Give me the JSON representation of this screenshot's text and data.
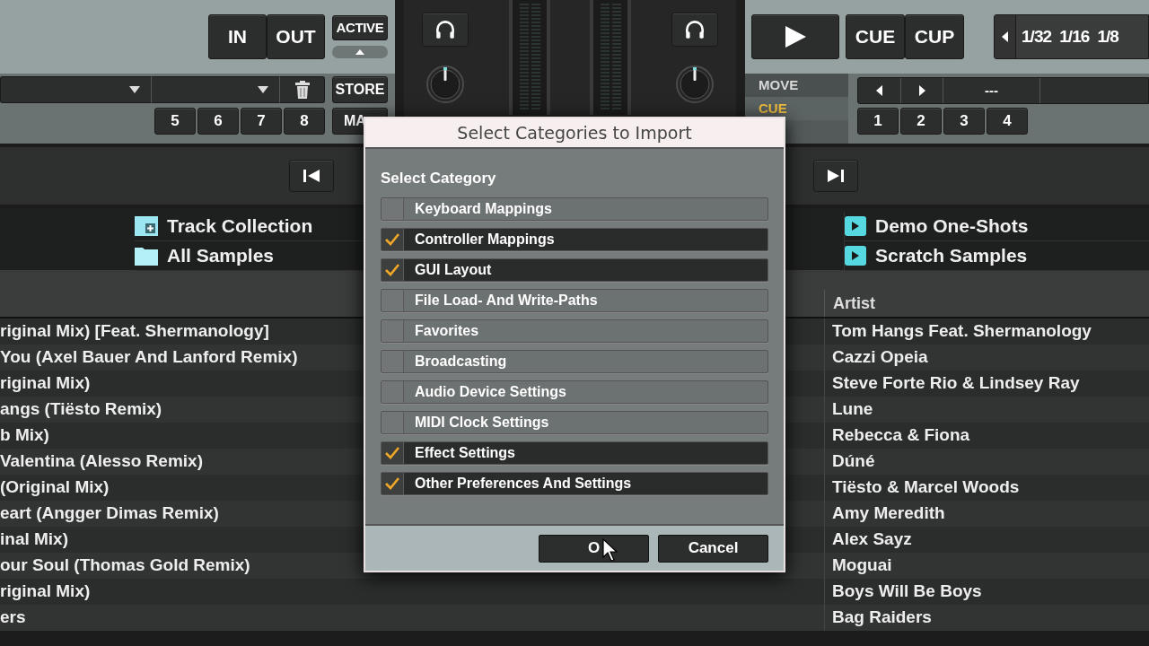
{
  "left_deck": {
    "loop_buttons": [
      "IN",
      "OUT"
    ],
    "active_button": "ACTIVE",
    "store_button": "STORE",
    "hotcue_buttons": [
      "5",
      "6",
      "7",
      "8"
    ],
    "map_button": "MA"
  },
  "right_deck": {
    "cue_buttons": [
      "CUE",
      "CUP"
    ],
    "loop_sizes": [
      "1/32",
      "1/16",
      "1/8"
    ],
    "modes": [
      {
        "label": "MOVE",
        "selected": false
      },
      {
        "label": "CUE",
        "selected": true
      }
    ],
    "jump_value": "---",
    "hotcue_buttons": [
      "1",
      "2",
      "3",
      "4"
    ]
  },
  "browser_tree": {
    "left": [
      {
        "label": "Track Collection",
        "kind": "collection"
      },
      {
        "label": "All Samples",
        "kind": "folder"
      }
    ],
    "right": [
      {
        "label": "Demo One-Shots",
        "kind": "playlist"
      },
      {
        "label": "Scratch Samples",
        "kind": "playlist"
      }
    ]
  },
  "track_list": {
    "artist_header": "Artist",
    "rows": [
      {
        "column_1": "riginal Mix) [Feat. Shermanology]",
        "artist": "Tom Hangs Feat. Shermanology"
      },
      {
        "column_1": "You (Axel Bauer And Lanford Remix)",
        "artist": "Cazzi Opeia"
      },
      {
        "column_1": "riginal Mix)",
        "artist": "Steve Forte Rio & Lindsey Ray"
      },
      {
        "column_1": "angs (Tiësto Remix)",
        "artist": "Lune"
      },
      {
        "column_1": "b Mix)",
        "artist": "Rebecca & Fiona"
      },
      {
        "column_1": "Valentina (Alesso Remix)",
        "artist": "Dúné"
      },
      {
        "column_1": "(Original Mix)",
        "artist": "Tiësto & Marcel Woods"
      },
      {
        "column_1": "eart (Angger Dimas Remix)",
        "artist": "Amy Meredith"
      },
      {
        "column_1": "inal Mix)",
        "artist": "Alex Sayz"
      },
      {
        "column_1": "our Soul (Thomas Gold Remix)",
        "artist": "Moguai"
      },
      {
        "column_1": "riginal Mix)",
        "artist": "Boys Will Be Boys"
      },
      {
        "column_1": "ers",
        "artist": "Bag Raiders"
      }
    ]
  },
  "dialog": {
    "title": "Select Categories to Import",
    "section_label": "Select Category",
    "categories": [
      {
        "label": "Keyboard Mappings",
        "checked": false
      },
      {
        "label": "Controller Mappings",
        "checked": true
      },
      {
        "label": "GUI Layout",
        "checked": true
      },
      {
        "label": "File Load- And Write-Paths",
        "checked": false
      },
      {
        "label": "Favorites",
        "checked": false
      },
      {
        "label": "Broadcasting",
        "checked": false
      },
      {
        "label": "Audio Device Settings",
        "checked": false
      },
      {
        "label": "MIDI Clock Settings",
        "checked": false
      },
      {
        "label": "Effect Settings",
        "checked": true
      },
      {
        "label": "Other Preferences And Settings",
        "checked": true
      }
    ],
    "buttons": [
      "O",
      "Cancel"
    ]
  }
}
